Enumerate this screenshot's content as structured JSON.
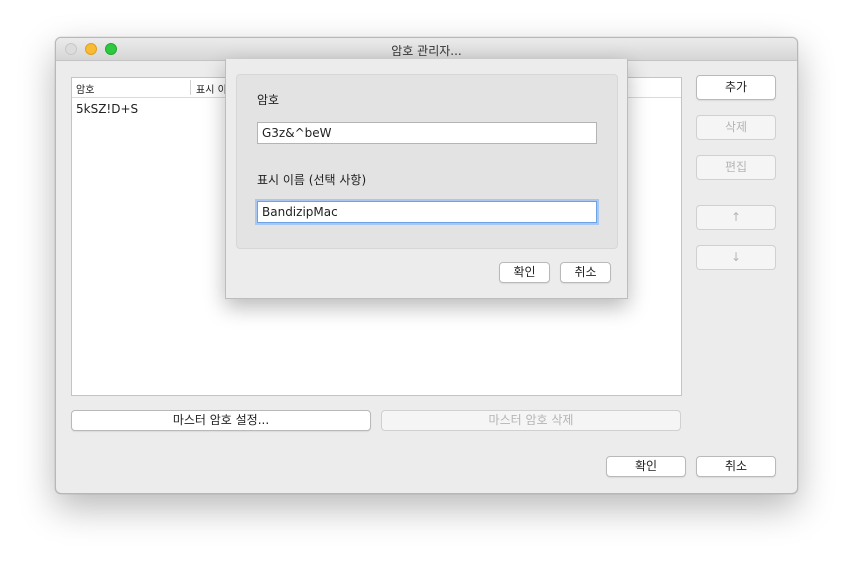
{
  "window": {
    "title": "암호 관리자..."
  },
  "table": {
    "columns": [
      "암호",
      "표시 이"
    ],
    "rows": [
      {
        "password": "5kSZ!D+S"
      }
    ]
  },
  "side_buttons": {
    "add": "추가",
    "delete": "삭제",
    "edit": "편집",
    "up": "↑",
    "down": "↓"
  },
  "master": {
    "set": "마스터 암호 설정...",
    "delete": "마스터 암호 삭제"
  },
  "footer": {
    "ok": "확인",
    "cancel": "취소"
  },
  "dialog": {
    "password_label": "암호",
    "password_value": "G3z&^beW",
    "display_name_label": "표시 이름 (선택 사항)",
    "display_name_value": "BandizipMac",
    "ok": "확인",
    "cancel": "취소"
  }
}
